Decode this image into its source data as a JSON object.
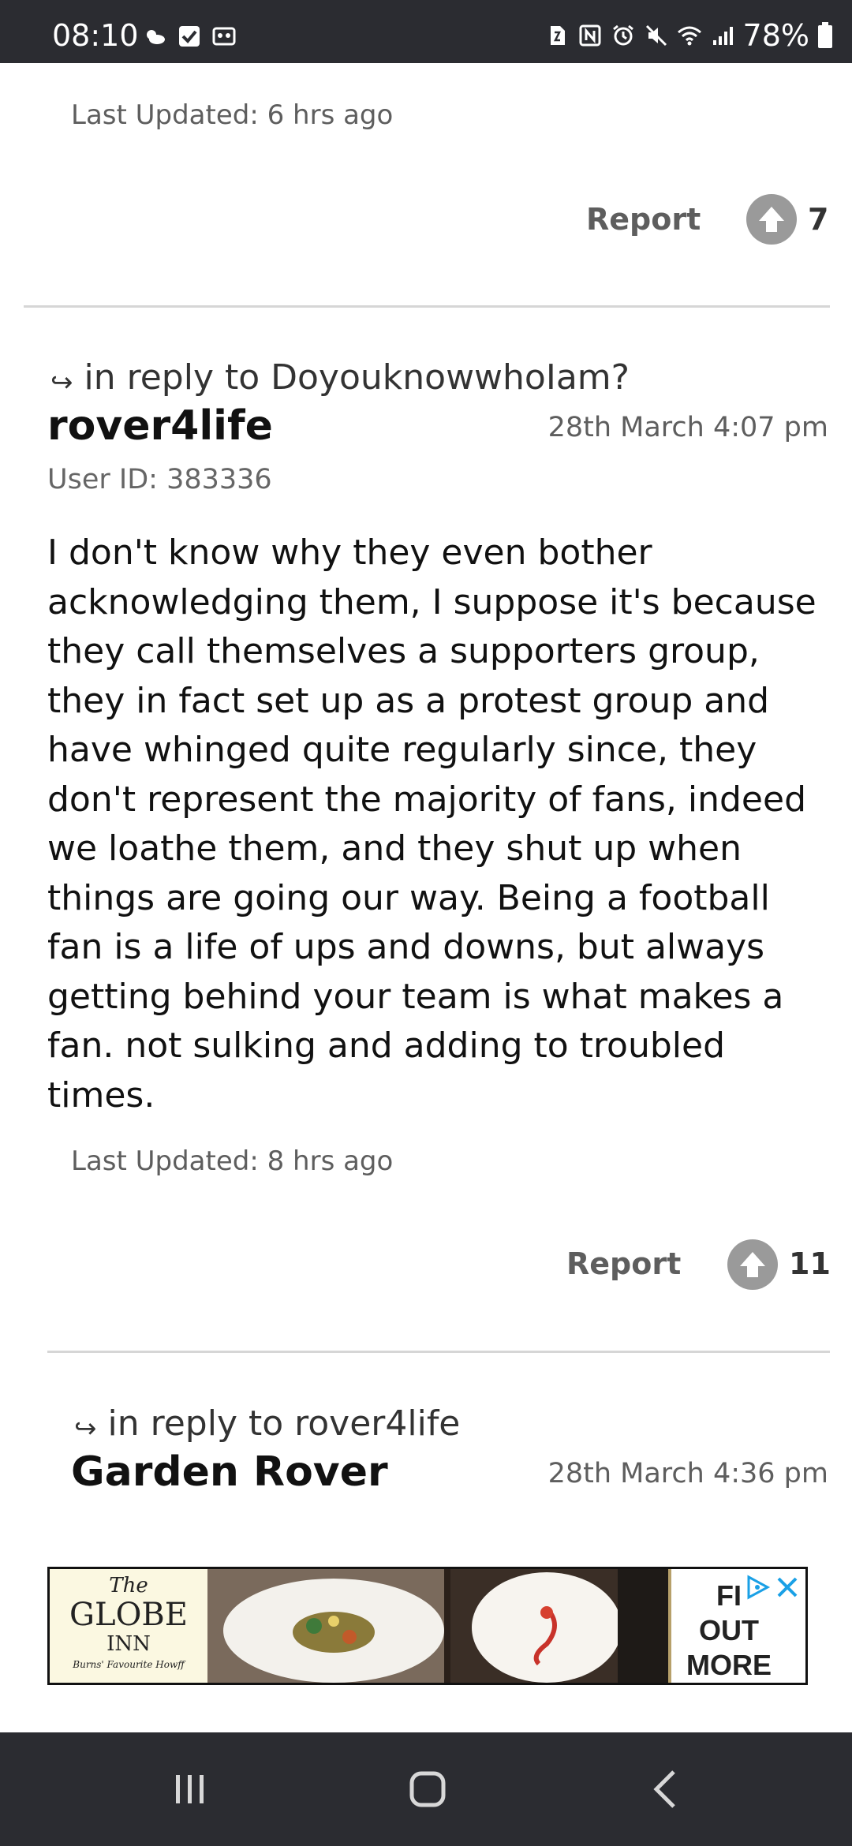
{
  "status_bar": {
    "time": "08:10",
    "left_icons": [
      "weather-icon",
      "checkbox-icon",
      "cast-icon"
    ],
    "right_icons": [
      "sim-icon",
      "nfc-icon",
      "alarm-icon",
      "mute-icon",
      "wifi-icon",
      "signal-icon"
    ],
    "battery_pct": "78%"
  },
  "comments": [
    {
      "last_updated": "Last Updated: 6 hrs ago",
      "report_label": "Report",
      "votes": "7"
    },
    {
      "reply_to": "in reply to DoyouknowwhoIam?",
      "author": "rover4life",
      "timestamp": "28th March 4:07 pm",
      "user_id": "User ID: 383336",
      "body": "I don't know why they even bother acknowledging them, I suppose it's because they call themselves a supporters group, they in fact set up as a protest group and have whinged quite regularly since, they don't represent the majority of fans, indeed we loathe them, and they shut up when things are going our way. Being a football fan is a life of ups and downs, but always getting behind your team is what makes a fan. not sulking and adding to troubled times.",
      "last_updated": "Last Updated: 8 hrs ago",
      "report_label": "Report",
      "votes": "11"
    },
    {
      "reply_to": "in reply to rover4life",
      "author": "Garden Rover",
      "timestamp": "28th March 4:36 pm"
    }
  ],
  "ad": {
    "logo_the": "The",
    "logo_globe": "GLOBE",
    "logo_inn": "INN",
    "logo_tag": "Burns' Favourite Howff",
    "cta_lines": [
      "FI",
      "OUT",
      "MORE"
    ]
  },
  "nav_bar": {
    "buttons": [
      "recent-apps-icon",
      "home-icon",
      "back-icon"
    ]
  }
}
